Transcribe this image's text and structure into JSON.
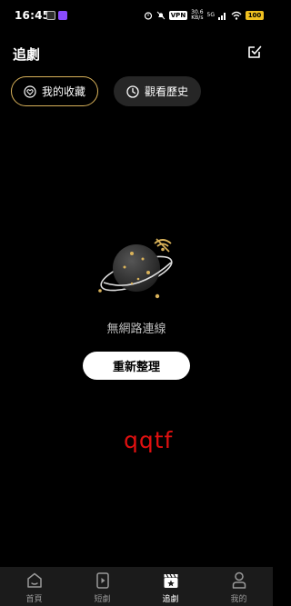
{
  "status_bar": {
    "time": "16:45",
    "network_speed": "30.6",
    "network_speed_unit": "KB/s",
    "vpn_label": "VPN",
    "network_type": "5G",
    "battery": "100"
  },
  "header": {
    "title": "追劇"
  },
  "tabs": [
    {
      "label": "我的收藏"
    },
    {
      "label": "觀看歷史"
    }
  ],
  "empty_state": {
    "message": "無網路連線",
    "button_label": "重新整理"
  },
  "overlay_text": "qqtf",
  "bottom_nav": [
    {
      "label": "首頁"
    },
    {
      "label": "短劇"
    },
    {
      "label": "追劇"
    },
    {
      "label": "我的"
    }
  ],
  "colors": {
    "background": "#000000",
    "accent_gold": "#d9b25a",
    "chip_inactive": "#262626",
    "nav_background": "#1b1b1b",
    "overlay_text": "#e01010"
  }
}
